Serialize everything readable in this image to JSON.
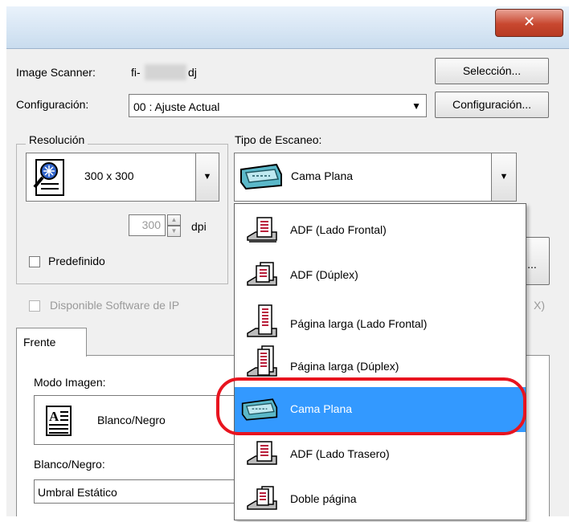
{
  "window": {
    "close_glyph": "✕"
  },
  "scanner": {
    "label": "Image Scanner:",
    "model_prefix": "fi-",
    "model_suffix": "dj",
    "select_button": "Selección..."
  },
  "config": {
    "label": "Configuración:",
    "value": "00 : Ajuste Actual",
    "button": "Configuración..."
  },
  "resolution": {
    "group_label": "Resolución",
    "value": "300 x 300",
    "dpi_value": "300",
    "dpi_unit": "dpi",
    "predefined_label": "Predefinido"
  },
  "scan_type": {
    "label": "Tipo de Escaneo:",
    "value": "Cama Plana",
    "options": [
      {
        "label": "ADF (Lado Frontal)",
        "icon": "adf-front-icon"
      },
      {
        "label": "ADF (Dúplex)",
        "icon": "adf-duplex-icon"
      },
      {
        "label": "Página larga (Lado Frontal)",
        "icon": "long-page-front-icon"
      },
      {
        "label": "Página larga (Dúplex)",
        "icon": "long-page-duplex-icon"
      },
      {
        "label": "Cama Plana",
        "icon": "flatbed-icon",
        "selected": true
      },
      {
        "label": "ADF (Lado Trasero)",
        "icon": "adf-back-icon"
      },
      {
        "label": "Doble página",
        "icon": "double-page-icon"
      }
    ]
  },
  "ipc": {
    "label": "Disponible  Software de IP",
    "trailing": "X)"
  },
  "tabs": {
    "front": "Frente"
  },
  "image_mode": {
    "label": "Modo Imagen:",
    "value": "Blanco/Negro"
  },
  "bw": {
    "label": "Blanco/Negro:",
    "value": "Umbral Estático"
  },
  "more_button": "...",
  "colors": {
    "selection": "#3399ff",
    "highlight_ring": "#e8141f",
    "close_button": "#c8472f"
  }
}
